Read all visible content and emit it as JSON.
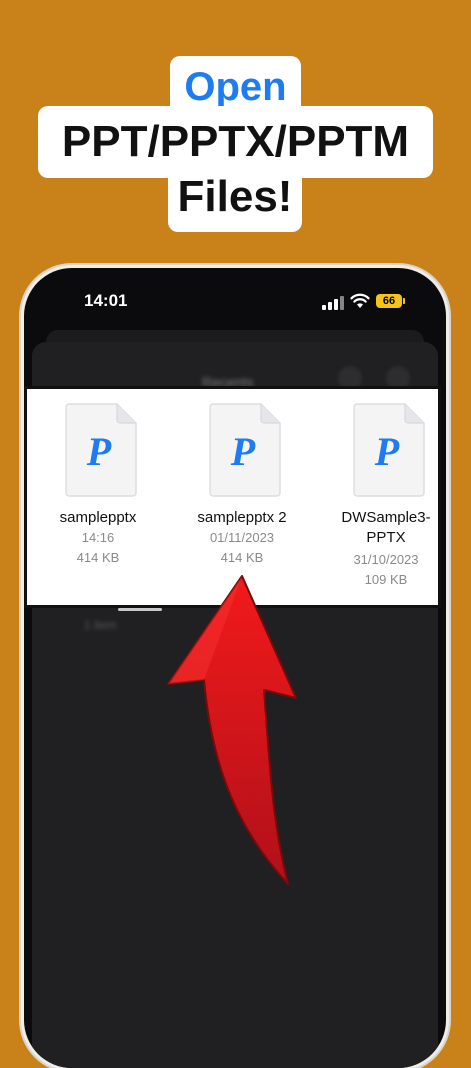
{
  "headline": {
    "line1": "Open",
    "line2": "PPT/PPTX/PPTM",
    "line3": "Files!"
  },
  "status_bar": {
    "time": "14:01",
    "battery": "66"
  },
  "sheet": {
    "title": "Recents",
    "subtitle": "1 item"
  },
  "files": [
    {
      "name": "samplepptx",
      "date": "14:16",
      "size": "414 KB",
      "icon": "pptx-file-icon"
    },
    {
      "name": "samplepptx 2",
      "date": "01/11/2023",
      "size": "414 KB",
      "icon": "pptx-file-icon"
    },
    {
      "name_line1": "DWSample3-",
      "name_line2": "PPTX",
      "date": "31/10/2023",
      "size": "109 KB",
      "icon": "pptx-file-icon"
    }
  ],
  "icon_letter": "P",
  "colors": {
    "background": "#C98219",
    "accent_blue": "#1E7BF0",
    "arrow_red": "#E8161B",
    "battery": "#F5C518"
  }
}
